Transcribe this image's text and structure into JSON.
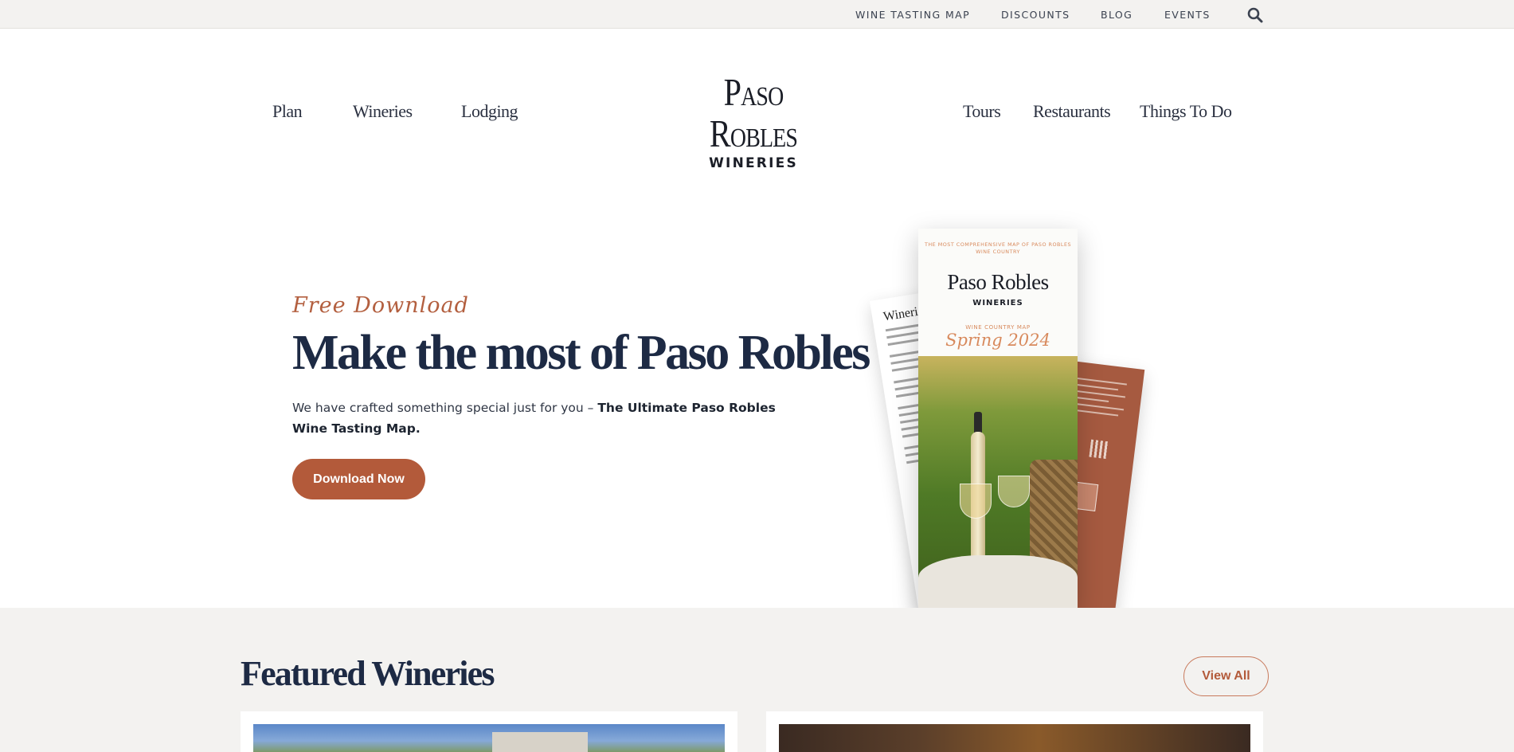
{
  "utility_nav": {
    "links": [
      "WINE TASTING MAP",
      "DISCOUNTS",
      "BLOG",
      "EVENTS"
    ],
    "search_icon": "search-icon"
  },
  "main_nav": {
    "left": [
      "Plan",
      "Wineries",
      "Lodging"
    ],
    "right": [
      "Tours",
      "Restaurants",
      "Things To Do"
    ]
  },
  "logo": {
    "title": "Paso Robles",
    "subtitle": "WINERIES"
  },
  "hero": {
    "eyebrow": "Free Download",
    "title": "Make the most of Paso Robles",
    "description_prefix": "We have crafted something special just for you – ",
    "description_bold": "The Ultimate Paso Robles Wine Tasting Map.",
    "button_label": "Download Now"
  },
  "brochure": {
    "tagline": "THE MOST COMPREHENSIVE MAP OF PASO ROBLES WINE COUNTRY",
    "logo_title": "Paso Robles",
    "logo_subtitle": "WINERIES",
    "map_label": "WINE COUNTRY MAP",
    "season": "Spring 2024",
    "side_heading": "Wineries"
  },
  "featured": {
    "title": "Featured Wineries",
    "view_all_label": "View All"
  },
  "colors": {
    "accent": "#b35a3a",
    "navy": "#1d2a44",
    "section_bg": "#f3f2f0",
    "utility_bg": "#f3f2f0"
  }
}
